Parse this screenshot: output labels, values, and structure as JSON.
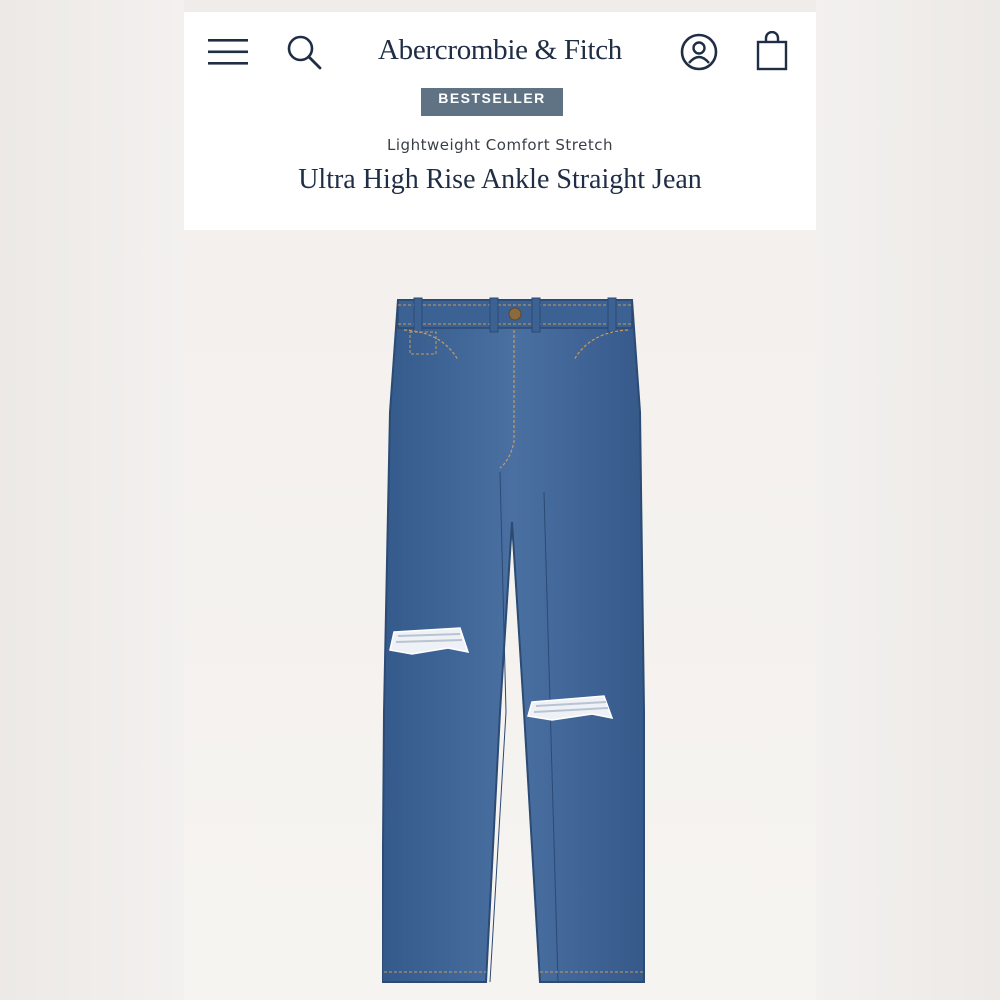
{
  "header": {
    "brand_name": "Abercrombie & Fitch",
    "icons": [
      "menu-icon",
      "search-icon",
      "account-icon",
      "shopping-bag-icon"
    ]
  },
  "product": {
    "badge": "BESTSELLER",
    "fabric": "Lightweight Comfort Stretch",
    "name": "Ultra High Rise Ankle Straight Jean"
  },
  "colors": {
    "brand_navy": "#1f2d45",
    "badge_bg": "#5f7384",
    "denim": "#3f6596"
  }
}
